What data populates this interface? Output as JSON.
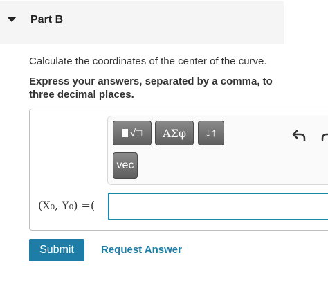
{
  "part": {
    "title": "Part B"
  },
  "question": {
    "text": "Calculate the coordinates of the center of the curve.",
    "instruction": "Express your answers, separated by a comma, to three decimal places."
  },
  "toolbar": {
    "templates_icon": "templates-radical-icon",
    "templates_glyph": "√□",
    "symbols_label": "ΑΣφ",
    "sort_label": "↓↑",
    "vec_label": "vec",
    "undo_icon": "undo-icon",
    "redo_icon": "redo-icon"
  },
  "answer": {
    "math_label": "(X₀, Y₀) =(",
    "value": ""
  },
  "actions": {
    "submit_label": "Submit",
    "request_label": "Request Answer"
  },
  "colors": {
    "accent": "#1e7da6",
    "input_border": "#1a87a8",
    "toolbar_button": "#6b6b6b"
  }
}
